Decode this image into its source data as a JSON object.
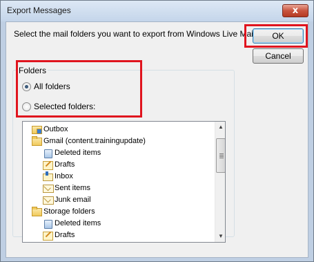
{
  "window": {
    "title": "Export Messages",
    "close_glyph": "x"
  },
  "instruction": "Select the mail folders you want to export from Windows Live Mail.",
  "buttons": {
    "ok": "OK",
    "cancel": "Cancel"
  },
  "folders_group": {
    "label": "Folders",
    "options": [
      {
        "label": "All folders",
        "checked": true
      },
      {
        "label": "Selected folders:",
        "checked": false
      }
    ]
  },
  "tree": {
    "items": [
      {
        "label": "Outbox",
        "icon": "outbox-folder-icon"
      },
      {
        "label": "Gmail (content.trainingupdate)",
        "icon": "mail-account-icon"
      },
      {
        "label": "Deleted items",
        "icon": "trash-icon"
      },
      {
        "label": "Drafts",
        "icon": "drafts-icon"
      },
      {
        "label": "Inbox",
        "icon": "inbox-icon"
      },
      {
        "label": "Sent items",
        "icon": "sent-folder-icon"
      },
      {
        "label": "Junk email",
        "icon": "junk-folder-icon"
      },
      {
        "label": "Storage folders",
        "icon": "folder-icon"
      },
      {
        "label": "Deleted items",
        "icon": "trash-icon"
      },
      {
        "label": "Drafts",
        "icon": "drafts-icon"
      }
    ]
  },
  "colors": {
    "highlight": "#e0141e",
    "dialog_bg": "#f0f0f0"
  }
}
